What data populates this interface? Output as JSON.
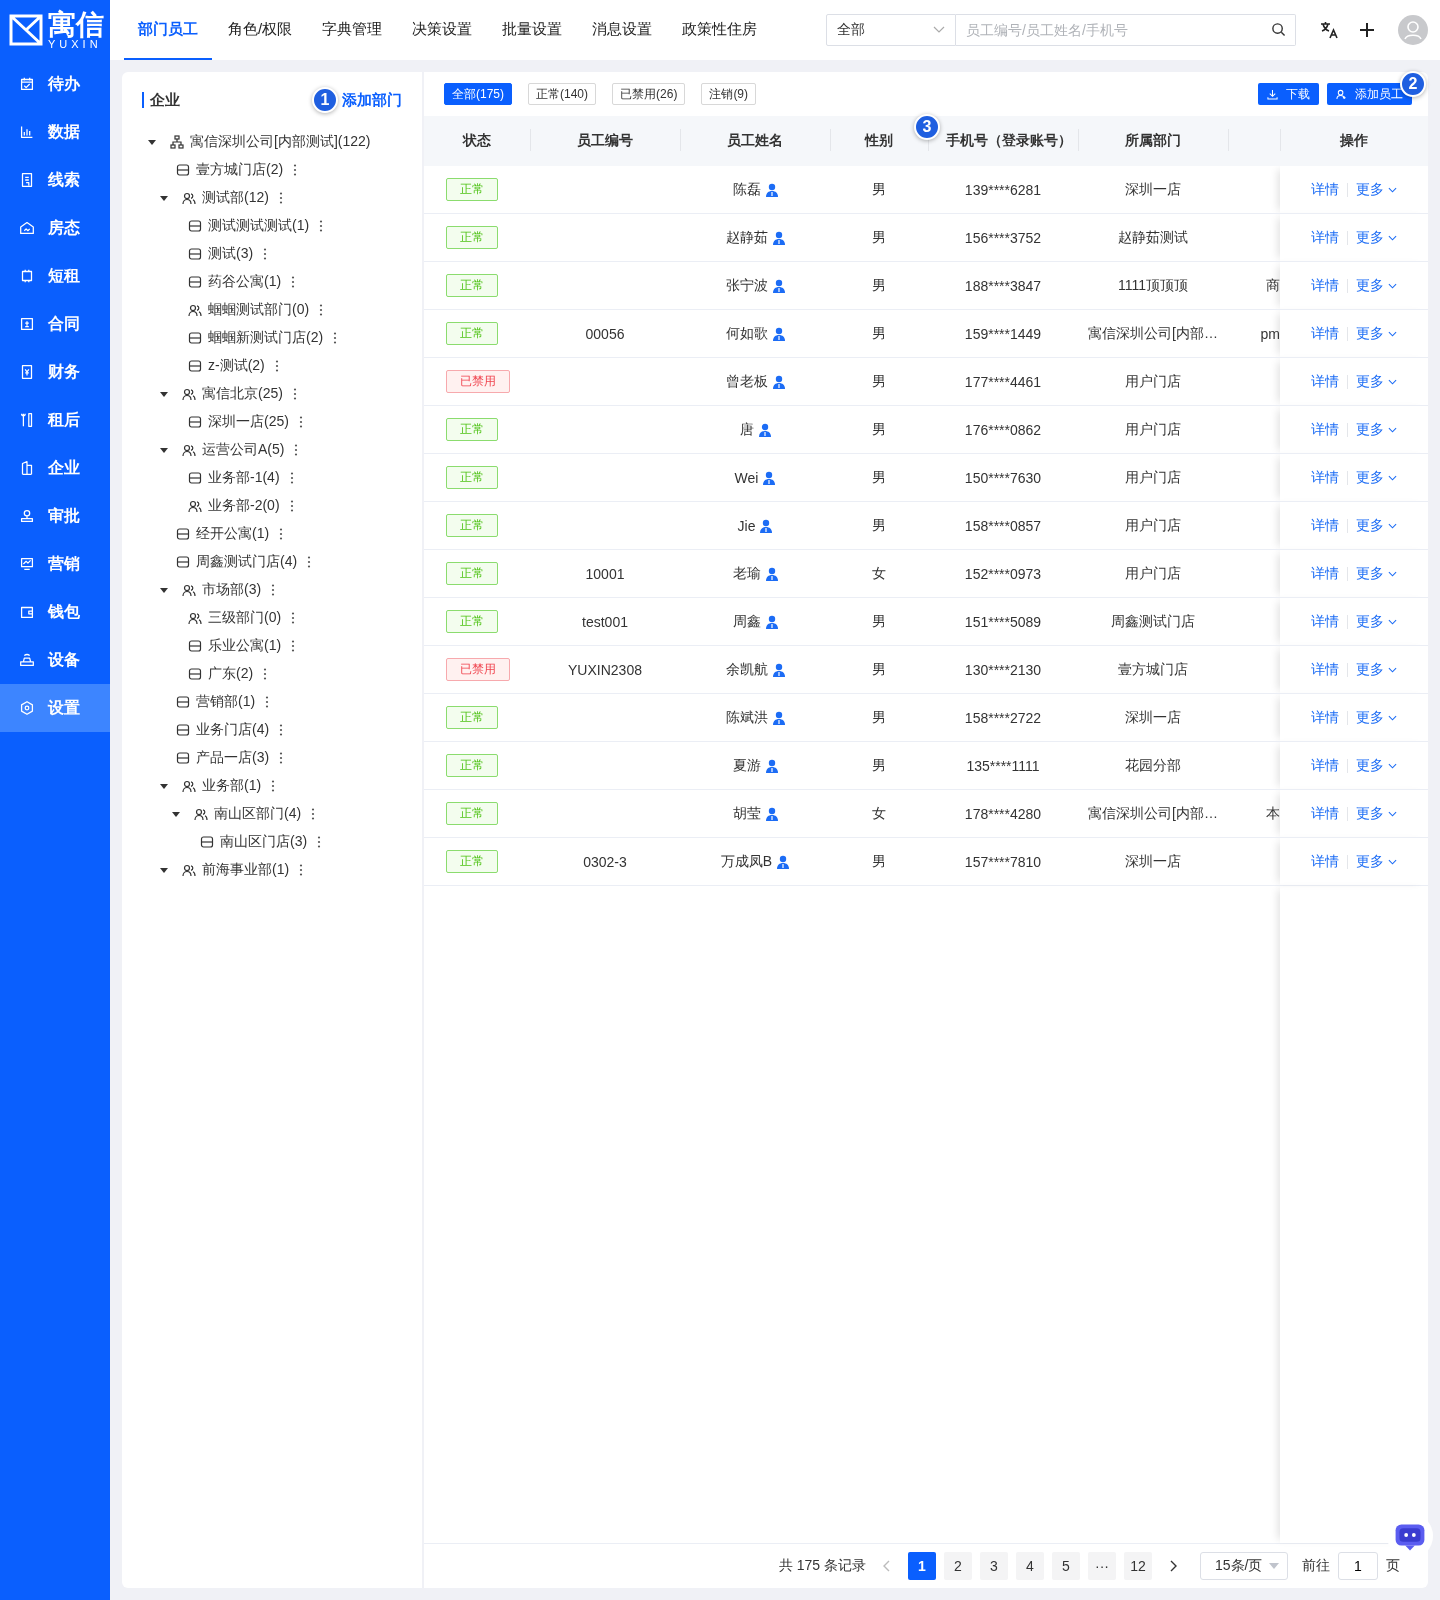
{
  "logo": {
    "name": "寓信",
    "sub": "YUXIN"
  },
  "top_tabs": [
    {
      "label": "部门员工",
      "selected": true
    },
    {
      "label": "角色/权限",
      "selected": false
    },
    {
      "label": "字典管理",
      "selected": false
    },
    {
      "label": "决策设置",
      "selected": false
    },
    {
      "label": "批量设置",
      "selected": false
    },
    {
      "label": "消息设置",
      "selected": false
    },
    {
      "label": "政策性住房",
      "selected": false
    }
  ],
  "search": {
    "scope": "全部",
    "placeholder": "员工编号/员工姓名/手机号"
  },
  "sidebar": {
    "items": [
      {
        "label": "待办",
        "selected": false
      },
      {
        "label": "数据",
        "selected": false
      },
      {
        "label": "线索",
        "selected": false
      },
      {
        "label": "房态",
        "selected": false
      },
      {
        "label": "短租",
        "selected": false
      },
      {
        "label": "合同",
        "selected": false
      },
      {
        "label": "财务",
        "selected": false
      },
      {
        "label": "租后",
        "selected": false
      },
      {
        "label": "企业",
        "selected": false
      },
      {
        "label": "审批",
        "selected": false
      },
      {
        "label": "营销",
        "selected": false
      },
      {
        "label": "钱包",
        "selected": false
      },
      {
        "label": "设备",
        "selected": false
      },
      {
        "label": "设置",
        "selected": true
      }
    ]
  },
  "tree_panel": {
    "title": "企业",
    "add_button": "添加部门",
    "tree": [
      {
        "label": "寓信深圳公司[内部测试](122)",
        "kind": "company",
        "expanded": true,
        "children": [
          {
            "label": "壹方城门店(2)",
            "kind": "store"
          },
          {
            "label": "测试部(12)",
            "kind": "department",
            "expanded": true,
            "children": [
              {
                "label": "测试测试测试(1)",
                "kind": "store"
              },
              {
                "label": "测试(3)",
                "kind": "store"
              },
              {
                "label": "药谷公寓(1)",
                "kind": "store"
              },
              {
                "label": "蝈蝈测试部门(0)",
                "kind": "department"
              },
              {
                "label": "蝈蝈新测试门店(2)",
                "kind": "store"
              },
              {
                "label": "z-测试(2)",
                "kind": "store"
              }
            ]
          },
          {
            "label": "寓信北京(25)",
            "kind": "department",
            "expanded": true,
            "children": [
              {
                "label": "深圳一店(25)",
                "kind": "store"
              }
            ]
          },
          {
            "label": "运营公司A(5)",
            "kind": "department",
            "expanded": true,
            "children": [
              {
                "label": "业务部-1(4)",
                "kind": "store"
              },
              {
                "label": "业务部-2(0)",
                "kind": "department"
              }
            ]
          },
          {
            "label": "经开公寓(1)",
            "kind": "store"
          },
          {
            "label": "周鑫测试门店(4)",
            "kind": "store"
          },
          {
            "label": "市场部(3)",
            "kind": "department",
            "expanded": true,
            "children": [
              {
                "label": "三级部门(0)",
                "kind": "department"
              },
              {
                "label": "乐业公寓(1)",
                "kind": "store"
              },
              {
                "label": "广东(2)",
                "kind": "store"
              }
            ]
          },
          {
            "label": "营销部(1)",
            "kind": "store"
          },
          {
            "label": "业务门店(4)",
            "kind": "store"
          },
          {
            "label": "产品一店(3)",
            "kind": "store"
          },
          {
            "label": "业务部(1)",
            "kind": "department",
            "expanded": true,
            "children": [
              {
                "label": "南山区部门(4)",
                "kind": "department",
                "expanded": true,
                "children": [
                  {
                    "label": "南山区门店(3)",
                    "kind": "store"
                  }
                ]
              }
            ]
          },
          {
            "label": "前海事业部(1)",
            "kind": "department",
            "expanded": true
          }
        ]
      }
    ]
  },
  "filters": [
    {
      "label": "全部(175)",
      "selected": true
    },
    {
      "label": "正常(140)",
      "selected": false
    },
    {
      "label": "已禁用(26)",
      "selected": false
    },
    {
      "label": "注销(9)",
      "selected": false
    }
  ],
  "toolbar": {
    "download": "下载",
    "add_employee": "添加员工"
  },
  "tour_markers": [
    "1",
    "2",
    "3"
  ],
  "table": {
    "columns": [
      "状态",
      "员工编号",
      "员工姓名",
      "性别",
      "手机号（登录账号）",
      "所属部门",
      "操作"
    ],
    "rows": [
      {
        "status": {
          "text": "正常",
          "kind": "normal"
        },
        "name": "陈磊",
        "gender": "男",
        "phone": "139****6281",
        "dept": "深圳一店",
        "actions": [
          "详情",
          "更多"
        ]
      },
      {
        "status": {
          "text": "正常",
          "kind": "normal"
        },
        "name": "赵静茹",
        "gender": "男",
        "phone": "156****3752",
        "dept": "赵静茹测试",
        "actions": [
          "详情",
          "更多"
        ]
      },
      {
        "status": {
          "text": "正常",
          "kind": "normal"
        },
        "name": "张宁波",
        "gender": "男",
        "phone": "188****3847",
        "dept": "1111顶顶顶",
        "column_7": "商",
        "actions": [
          "详情",
          "更多"
        ]
      },
      {
        "status": {
          "text": "正常",
          "kind": "normal"
        },
        "id": "00056",
        "name": "何如歌",
        "gender": "男",
        "phone": "159****1449",
        "dept": "寓信深圳公司[内部…",
        "column_7": "pm",
        "actions": [
          "详情",
          "更多"
        ]
      },
      {
        "status": {
          "text": "已禁用",
          "kind": "disabled"
        },
        "name": "曾老板",
        "gender": "男",
        "phone": "177****4461",
        "dept": "用户门店",
        "actions": [
          "详情",
          "更多"
        ]
      },
      {
        "status": {
          "text": "正常",
          "kind": "normal"
        },
        "name": "唐",
        "gender": "男",
        "phone": "176****0862",
        "dept": "用户门店",
        "actions": [
          "详情",
          "更多"
        ]
      },
      {
        "status": {
          "text": "正常",
          "kind": "normal"
        },
        "name": "Wei",
        "gender": "男",
        "phone": "150****7630",
        "dept": "用户门店",
        "actions": [
          "详情",
          "更多"
        ]
      },
      {
        "status": {
          "text": "正常",
          "kind": "normal"
        },
        "name": "Jie",
        "gender": "男",
        "phone": "158****0857",
        "dept": "用户门店",
        "actions": [
          "详情",
          "更多"
        ]
      },
      {
        "status": {
          "text": "正常",
          "kind": "normal"
        },
        "id": "10001",
        "name": "老瑜",
        "gender": "女",
        "phone": "152****0973",
        "dept": "用户门店",
        "actions": [
          "详情",
          "更多"
        ]
      },
      {
        "status": {
          "text": "正常",
          "kind": "normal"
        },
        "id": "test001",
        "name": "周鑫",
        "gender": "男",
        "phone": "151****5089",
        "dept": "周鑫测试门店",
        "actions": [
          "详情",
          "更多"
        ]
      },
      {
        "status": {
          "text": "已禁用",
          "kind": "disabled"
        },
        "id": "YUXIN2308",
        "name": "余凯航",
        "gender": "男",
        "phone": "130****2130",
        "dept": "壹方城门店",
        "actions": [
          "详情",
          "更多"
        ]
      },
      {
        "status": {
          "text": "正常",
          "kind": "normal"
        },
        "name": "陈斌洪",
        "gender": "男",
        "phone": "158****2722",
        "dept": "深圳一店",
        "actions": [
          "详情",
          "更多"
        ]
      },
      {
        "status": {
          "text": "正常",
          "kind": "normal"
        },
        "name": "夏游",
        "gender": "男",
        "phone": "135****1111",
        "dept": "花园分部",
        "actions": [
          "详情",
          "更多"
        ]
      },
      {
        "status": {
          "text": "正常",
          "kind": "normal"
        },
        "name": "胡莹",
        "gender": "女",
        "phone": "178****4280",
        "dept": "寓信深圳公司[内部…",
        "column_7": "本",
        "actions": [
          "详情",
          "更多"
        ]
      },
      {
        "status": {
          "text": "正常",
          "kind": "normal"
        },
        "id": "0302-3",
        "name": "万成凤B",
        "gender": "男",
        "phone": "157****7810",
        "dept": "深圳一店",
        "actions": [
          "详情",
          "更多"
        ]
      }
    ]
  },
  "pagination": {
    "total": "共 175 条记录",
    "pages": [
      {
        "label": "1",
        "selected": true
      },
      {
        "label": "2",
        "selected": false
      },
      {
        "label": "3",
        "selected": false
      },
      {
        "label": "4",
        "selected": false
      },
      {
        "label": "5",
        "selected": false
      },
      {
        "label": "···",
        "selected": false
      },
      {
        "label": "12",
        "selected": false
      }
    ],
    "page_size": "15条/页",
    "goto_label": "前往",
    "goto_value": "1",
    "goto_suffix": "页"
  }
}
